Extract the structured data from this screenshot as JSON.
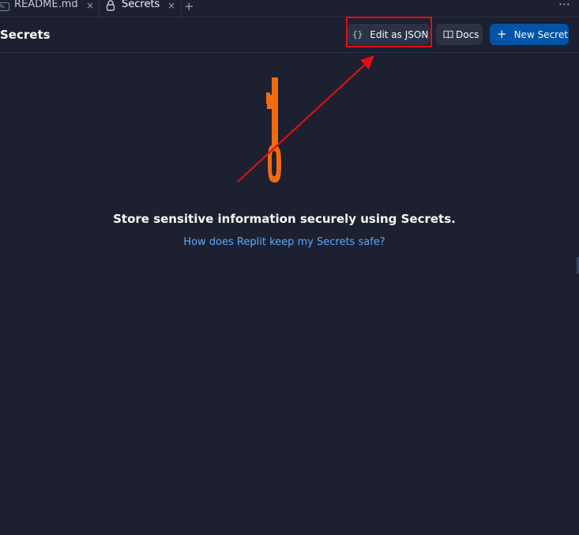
{
  "tabs": [
    {
      "label": "README.md",
      "icon": "markdown-icon",
      "badge": "M↓",
      "close": "×"
    },
    {
      "label": "Secrets",
      "icon": "lock-icon",
      "close": "×"
    }
  ],
  "tabbar": {
    "add_tab": "+",
    "more": "⋯"
  },
  "header": {
    "title": "Secrets",
    "edit_json_icon": "{}",
    "edit_json_label": "Edit as JSON",
    "docs_label": "Docs",
    "new_secret_icon": "+",
    "new_secret_label": "New Secret"
  },
  "empty_state": {
    "message": "Store sensitive information securely using Secrets.",
    "help_link": "How does Replit keep my Secrets safe?"
  },
  "colors": {
    "background": "#1c2030",
    "button": "#2b3245",
    "primary": "#0053a6",
    "link": "#57abff",
    "key_illustration": "#f26b0f",
    "annotation": "#e01010"
  }
}
